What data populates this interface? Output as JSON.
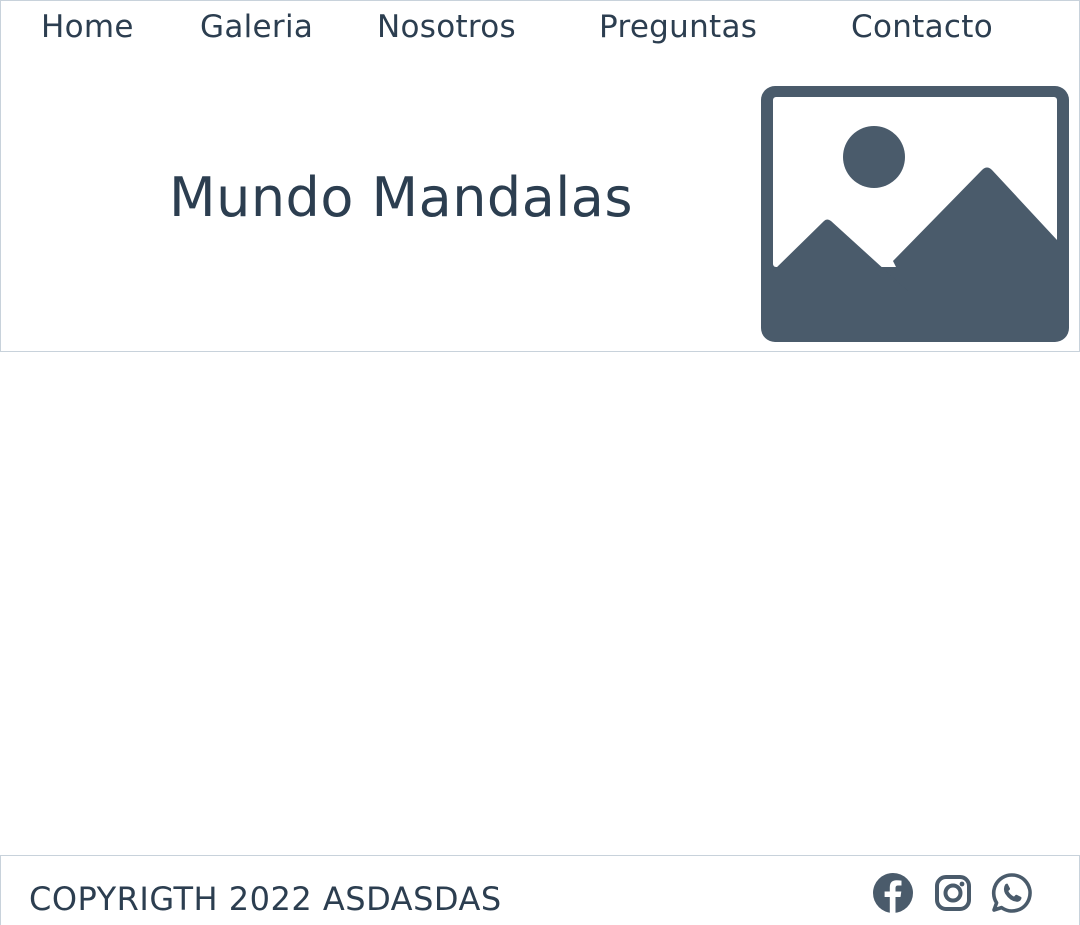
{
  "nav": {
    "items": [
      {
        "label": "Home"
      },
      {
        "label": "Galeria"
      },
      {
        "label": "Nosotros"
      },
      {
        "label": "Preguntas"
      },
      {
        "label": "Contacto"
      }
    ]
  },
  "hero": {
    "title": "Mundo Mandalas",
    "image_icon": "image-placeholder-icon"
  },
  "footer": {
    "copyright": "COPYRIGTH 2022 ASDASDAS",
    "social": [
      "facebook-icon",
      "instagram-icon",
      "whatsapp-icon"
    ]
  },
  "colors": {
    "text": "#2c3e50",
    "icon": "#4a5b6b",
    "border": "#c8d2db"
  }
}
